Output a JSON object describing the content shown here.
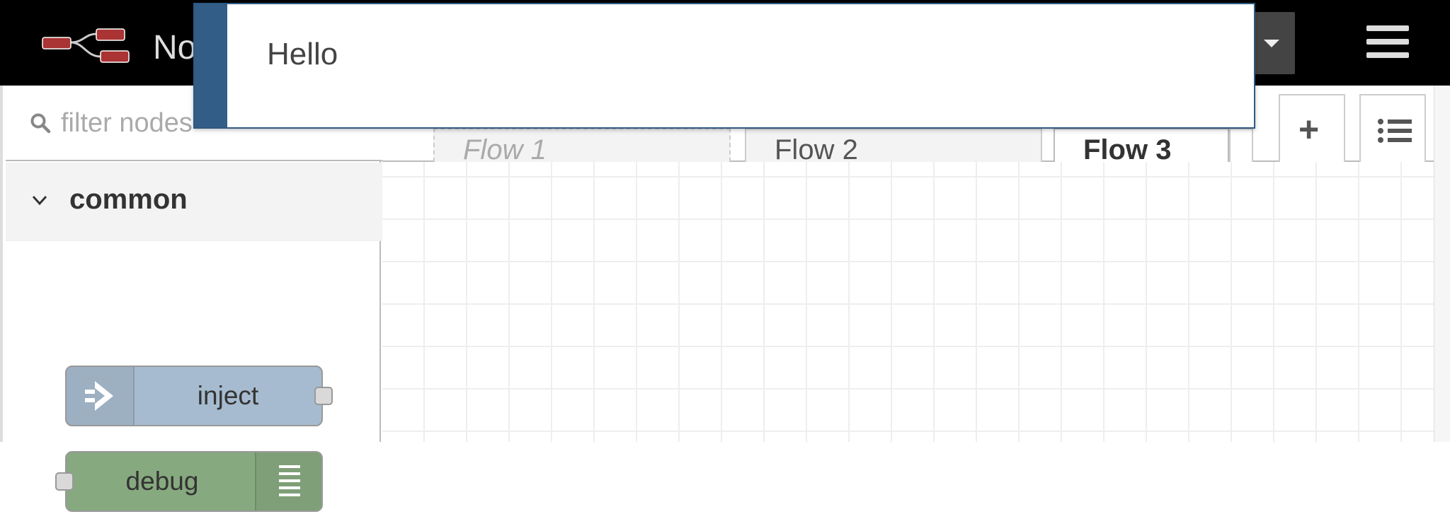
{
  "header": {
    "title": "No",
    "logo_icon": "node-red-logo-icon",
    "deploy_menu_icon": "caret-down-icon",
    "main_menu_icon": "hamburger-menu-icon",
    "background": "#000000"
  },
  "palette": {
    "search": {
      "placeholder": "filter nodes",
      "value": "",
      "icon": "search-icon"
    },
    "category": {
      "label": "common",
      "icon": "chevron-down-icon"
    },
    "nodes": [
      {
        "label": "inject",
        "color": "#a6bbcf",
        "icon": "inject-arrow-icon"
      },
      {
        "label": "debug",
        "color": "#87a980",
        "icon": "debug-list-icon"
      }
    ]
  },
  "workspace": {
    "tabs": [
      {
        "label": "Flow 1",
        "state": "disabled"
      },
      {
        "label": "Flow 2",
        "state": "inactive"
      },
      {
        "label": "Flow 3",
        "state": "active"
      }
    ],
    "add_flow_icon": "plus-icon",
    "flow_list_icon": "list-icon"
  },
  "notification": {
    "text": "Hello",
    "accent": "#325d86"
  }
}
